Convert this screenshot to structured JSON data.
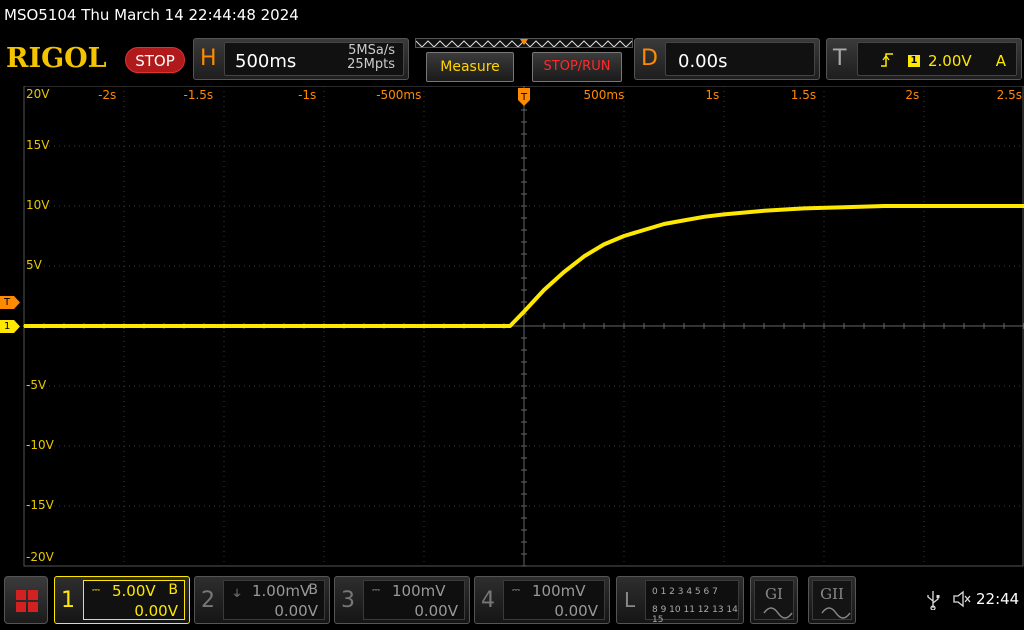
{
  "title": "MSO5104  Thu March 14 22:44:48 2024",
  "header": {
    "brand": "RIGOL",
    "run_state": "STOP",
    "horizontal": {
      "letter": "H",
      "timebase": "500ms",
      "sample_rate": "5MSa/s",
      "memory_depth": "25Mpts"
    },
    "measure_label": "Measure",
    "stop_run_label": "STOP/RUN",
    "delay": {
      "letter": "D",
      "value": "0.00s"
    },
    "trigger": {
      "letter": "T",
      "source": "1",
      "level": "2.00V",
      "mode": "A",
      "edge_icon": "rising-edge-icon"
    }
  },
  "grid": {
    "y_labels": [
      "20V",
      "15V",
      "10V",
      "5V",
      "",
      "-5V",
      "-10V",
      "-15V",
      "-20V"
    ],
    "x_labels": [
      "-2s",
      "-1.5s",
      "-1s",
      "-500ms",
      "500ms",
      "1s",
      "1.5s",
      "2s",
      "2.5s"
    ],
    "trigger_marker": "T",
    "channel_marker": "1"
  },
  "chart_data": {
    "type": "line",
    "title": "",
    "xlabel": "",
    "ylabel": "",
    "xlim": [
      -2.5,
      2.5
    ],
    "ylim": [
      -20,
      20
    ],
    "series": [
      {
        "color": "#ffe800",
        "x": [
          -2.5,
          -0.07,
          0.0,
          0.1,
          0.2,
          0.3,
          0.4,
          0.5,
          0.6,
          0.7,
          0.8,
          0.9,
          1.0,
          1.2,
          1.4,
          1.6,
          1.8,
          2.0,
          2.5
        ],
        "y": [
          0.0,
          0.0,
          1.2,
          3.0,
          4.5,
          5.8,
          6.8,
          7.5,
          8.0,
          8.5,
          8.8,
          9.1,
          9.3,
          9.6,
          9.8,
          9.9,
          10.0,
          10.0,
          10.0
        ]
      }
    ]
  },
  "footer": {
    "channels": [
      {
        "num": "1",
        "scale": "5.00V",
        "bw": "B",
        "offset": "0.00V",
        "coupling_icon": "dc-coupling-icon"
      },
      {
        "num": "2",
        "scale": "1.00mV",
        "bw": "B",
        "offset": "0.00V",
        "coupling_icon": "gnd-coupling-icon"
      },
      {
        "num": "3",
        "scale": "100mV",
        "bw": "",
        "offset": "0.00V",
        "coupling_icon": "dc-coupling-icon"
      },
      {
        "num": "4",
        "scale": "100mV",
        "bw": "",
        "offset": "0.00V",
        "coupling_icon": "dc-coupling-icon"
      }
    ],
    "logic": {
      "label": "L",
      "row1": "0 1 2 3  4 5 6 7",
      "row2": "8 9 10 11 12 13 14 15"
    },
    "gen1": "GI",
    "gen2": "GII",
    "time": "22:44"
  },
  "colors": {
    "ch1": "#ffe800",
    "accent": "#ff8a00",
    "stop": "#b01a1a",
    "brand": "#f5c400"
  }
}
